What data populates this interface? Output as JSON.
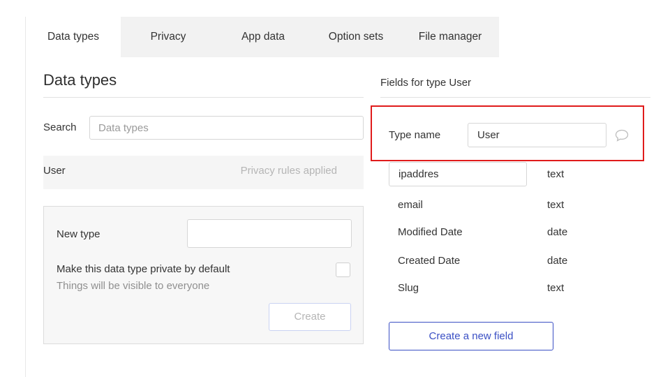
{
  "tabs": [
    {
      "label": "Data types",
      "active": true
    },
    {
      "label": "Privacy",
      "active": false
    },
    {
      "label": "App data",
      "active": false
    },
    {
      "label": "Option sets",
      "active": false
    },
    {
      "label": "File manager",
      "active": false
    }
  ],
  "left": {
    "title": "Data types",
    "search": {
      "label": "Search",
      "placeholder": "Data types",
      "value": ""
    },
    "types": [
      {
        "name": "User",
        "status": "Privacy rules applied"
      }
    ],
    "new_type": {
      "label": "New type",
      "value": "",
      "private_label": "Make this data type private by default",
      "private_sub": "Things will be visible to everyone",
      "private_checked": false,
      "create_label": "Create"
    }
  },
  "right": {
    "title": "Fields for type User",
    "type_name_label": "Type name",
    "type_name_value": "User",
    "comment_icon": "speech-bubble-icon",
    "fields": [
      {
        "name": "ipaddres",
        "type": "text"
      },
      {
        "name": "email",
        "type": "text"
      },
      {
        "name": "Modified Date",
        "type": "date"
      },
      {
        "name": "Created Date",
        "type": "date"
      },
      {
        "name": "Slug",
        "type": "text"
      }
    ],
    "new_field_label": "Create a new field"
  },
  "colors": {
    "highlight": "#e01b1b",
    "accent": "#3a4fc4",
    "tab_bg": "#f2f2f2"
  }
}
